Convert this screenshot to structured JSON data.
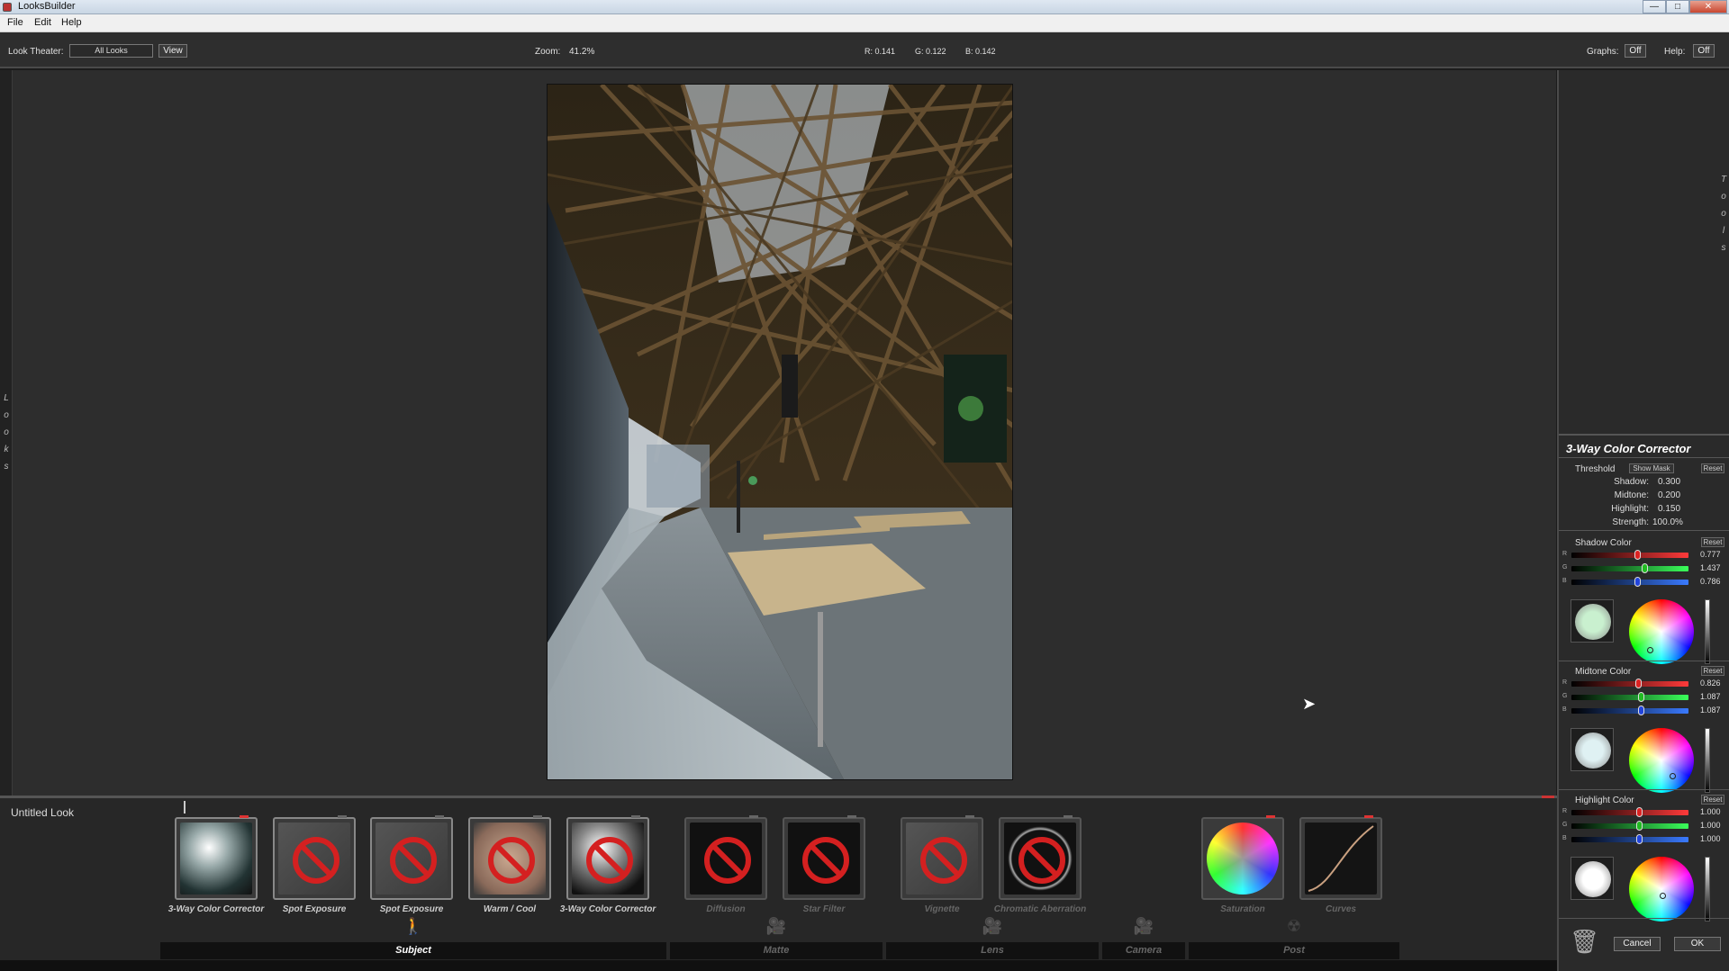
{
  "window": {
    "title": "LooksBuilder",
    "minimize": "—",
    "maximize": "□",
    "close": "✕"
  },
  "menu": {
    "items": [
      "File",
      "Edit",
      "Help"
    ]
  },
  "toolbar": {
    "look_theater_label": "Look Theater:",
    "look_theater_value": "All Looks",
    "view_button": "View",
    "zoom_label": "Zoom:",
    "zoom_value": "41.2%",
    "r": "R: 0.141",
    "g": "G: 0.122",
    "b": "B: 0.142",
    "graphs_label": "Graphs:",
    "graphs_value": "Off",
    "help_label": "Help:",
    "help_value": "Off"
  },
  "left_strip": {
    "letters": [
      "L",
      "o",
      "o",
      "k",
      "s"
    ]
  },
  "tools_strip": {
    "letters": [
      "T",
      "o",
      "o",
      "l",
      "s"
    ]
  },
  "panel": {
    "title": "3-Way Color Corrector",
    "threshold": {
      "label": "Threshold",
      "show_mask": "Show Mask",
      "reset": "Reset",
      "shadow_label": "Shadow:",
      "shadow_value": "0.300",
      "midtone_label": "Midtone:",
      "midtone_value": "0.200",
      "highlight_label": "Highlight:",
      "highlight_value": "0.150",
      "strength_label": "Strength:",
      "strength_value": "100.0%"
    },
    "shadow": {
      "label": "Shadow Color",
      "reset": "Reset",
      "r": "0.777",
      "g": "1.437",
      "b": "0.786",
      "swatch": "#c9f0cf",
      "r_pos": 0.56,
      "g_pos": 0.62,
      "b_pos": 0.56
    },
    "midtone": {
      "label": "Midtone Color",
      "reset": "Reset",
      "r": "0.826",
      "g": "1.087",
      "b": "1.087",
      "swatch": "#dff1f3",
      "r_pos": 0.57,
      "g_pos": 0.59,
      "b_pos": 0.59
    },
    "highlight": {
      "label": "Highlight Color",
      "reset": "Reset",
      "r": "1.000",
      "g": "1.000",
      "b": "1.000",
      "swatch": "#ffffff",
      "r_pos": 0.58,
      "g_pos": 0.58,
      "b_pos": 0.58
    },
    "cancel": "Cancel",
    "ok": "OK"
  },
  "look": {
    "name": "Untitled Look",
    "tiles": [
      {
        "label": "3-Way Color Corrector",
        "kind": "sphere",
        "disabled": false
      },
      {
        "label": "Spot Exposure",
        "kind": "no",
        "disabled": false
      },
      {
        "label": "Spot Exposure",
        "kind": "no",
        "disabled": false
      },
      {
        "label": "Warm / Cool",
        "kind": "no-warm",
        "disabled": false
      },
      {
        "label": "3-Way Color Corrector",
        "kind": "no-sphere",
        "disabled": false
      },
      {
        "label": "Diffusion",
        "kind": "no-dark",
        "disabled": true
      },
      {
        "label": "Star Filter",
        "kind": "no-dark",
        "disabled": true
      },
      {
        "label": "Vignette",
        "kind": "no",
        "disabled": true
      },
      {
        "label": "Chromatic Aberration",
        "kind": "no-ring",
        "disabled": true
      },
      {
        "label": "Saturation",
        "kind": "sat",
        "disabled": true
      },
      {
        "label": "Curves",
        "kind": "curve",
        "disabled": true
      }
    ],
    "categories": [
      "Subject",
      "Matte",
      "Lens",
      "Camera",
      "Post"
    ]
  },
  "colors": {
    "accent_red": "#d42020",
    "panel_bg": "#2a2a2a"
  }
}
